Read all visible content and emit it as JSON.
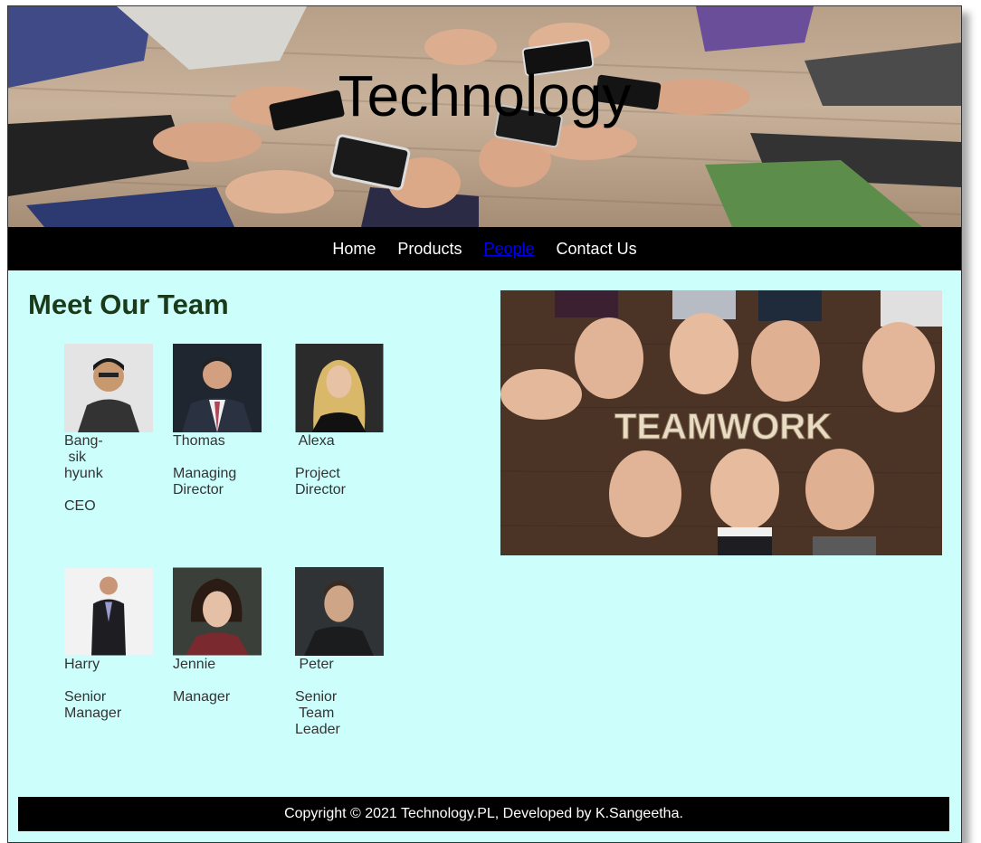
{
  "header": {
    "title": "Technology"
  },
  "nav": {
    "items": [
      {
        "label": "Home",
        "active": false
      },
      {
        "label": "Products",
        "active": false
      },
      {
        "label": "People",
        "active": true
      },
      {
        "label": "Contact Us",
        "active": false
      }
    ]
  },
  "main": {
    "heading": "Meet Our Team",
    "team": [
      {
        "name": "Bang-\n sik\nhyunk",
        "role": "CEO"
      },
      {
        "name": "Thomas",
        "role": "Managing\nDirector"
      },
      {
        "name": " Alexa",
        "role": "Project\nDirector"
      },
      {
        "name": "Harry",
        "role": "Senior\nManager"
      },
      {
        "name": "Jennie",
        "role": "Manager"
      },
      {
        "name": " Peter",
        "role": "Senior\n Team\nLeader"
      }
    ],
    "teamwork_image_text": "TEAMWORK"
  },
  "footer": {
    "text": "Copyright © 2021 Technology.PL, Developed by K.Sangeetha."
  },
  "colors": {
    "page_bg": "#ccfffc",
    "nav_bg": "#000000",
    "active_link": "#0000ee",
    "heading": "#1a3a1a"
  }
}
